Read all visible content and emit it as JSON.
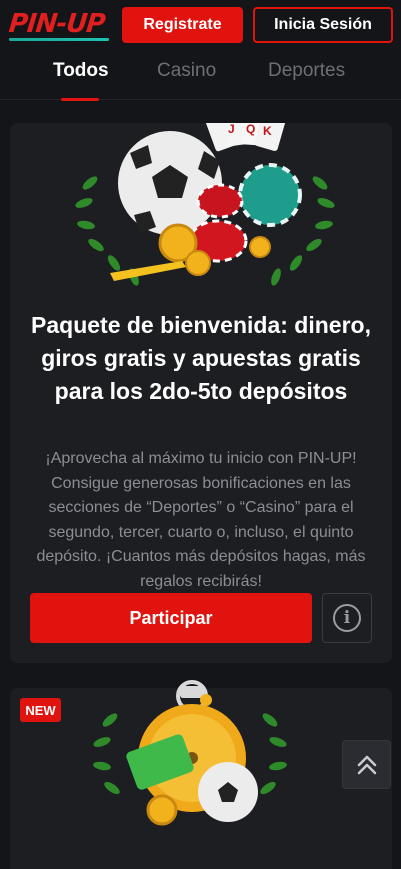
{
  "header": {
    "logo_text": "PIN-UP",
    "register_label": "Registrate",
    "login_label": "Inicia Sesión"
  },
  "tabs": [
    {
      "label": "Todos",
      "active": true
    },
    {
      "label": "Casino",
      "active": false
    },
    {
      "label": "Deportes",
      "active": false
    }
  ],
  "promo1": {
    "title": "Paquete de bienvenida: dinero, giros gratis y apuestas gratis para los 2do-5to depósitos",
    "description": "¡Aprovecha al máximo tu inicio con PIN-UP! Consigue generosas bonificaciones en las secciones de “Deportes” o “Casino” para el segundo, tercer, cuarto o, incluso, el quinto depósito. ¡Cuantos más depósitos hagas, más regalos recibirás!",
    "cta_label": "Participar",
    "info_icon": "info-icon"
  },
  "promo2": {
    "badge": "NEW"
  },
  "colors": {
    "accent": "#e0130f",
    "background": "#141518",
    "card": "#1d1e22",
    "muted_text": "#8b8e95"
  }
}
